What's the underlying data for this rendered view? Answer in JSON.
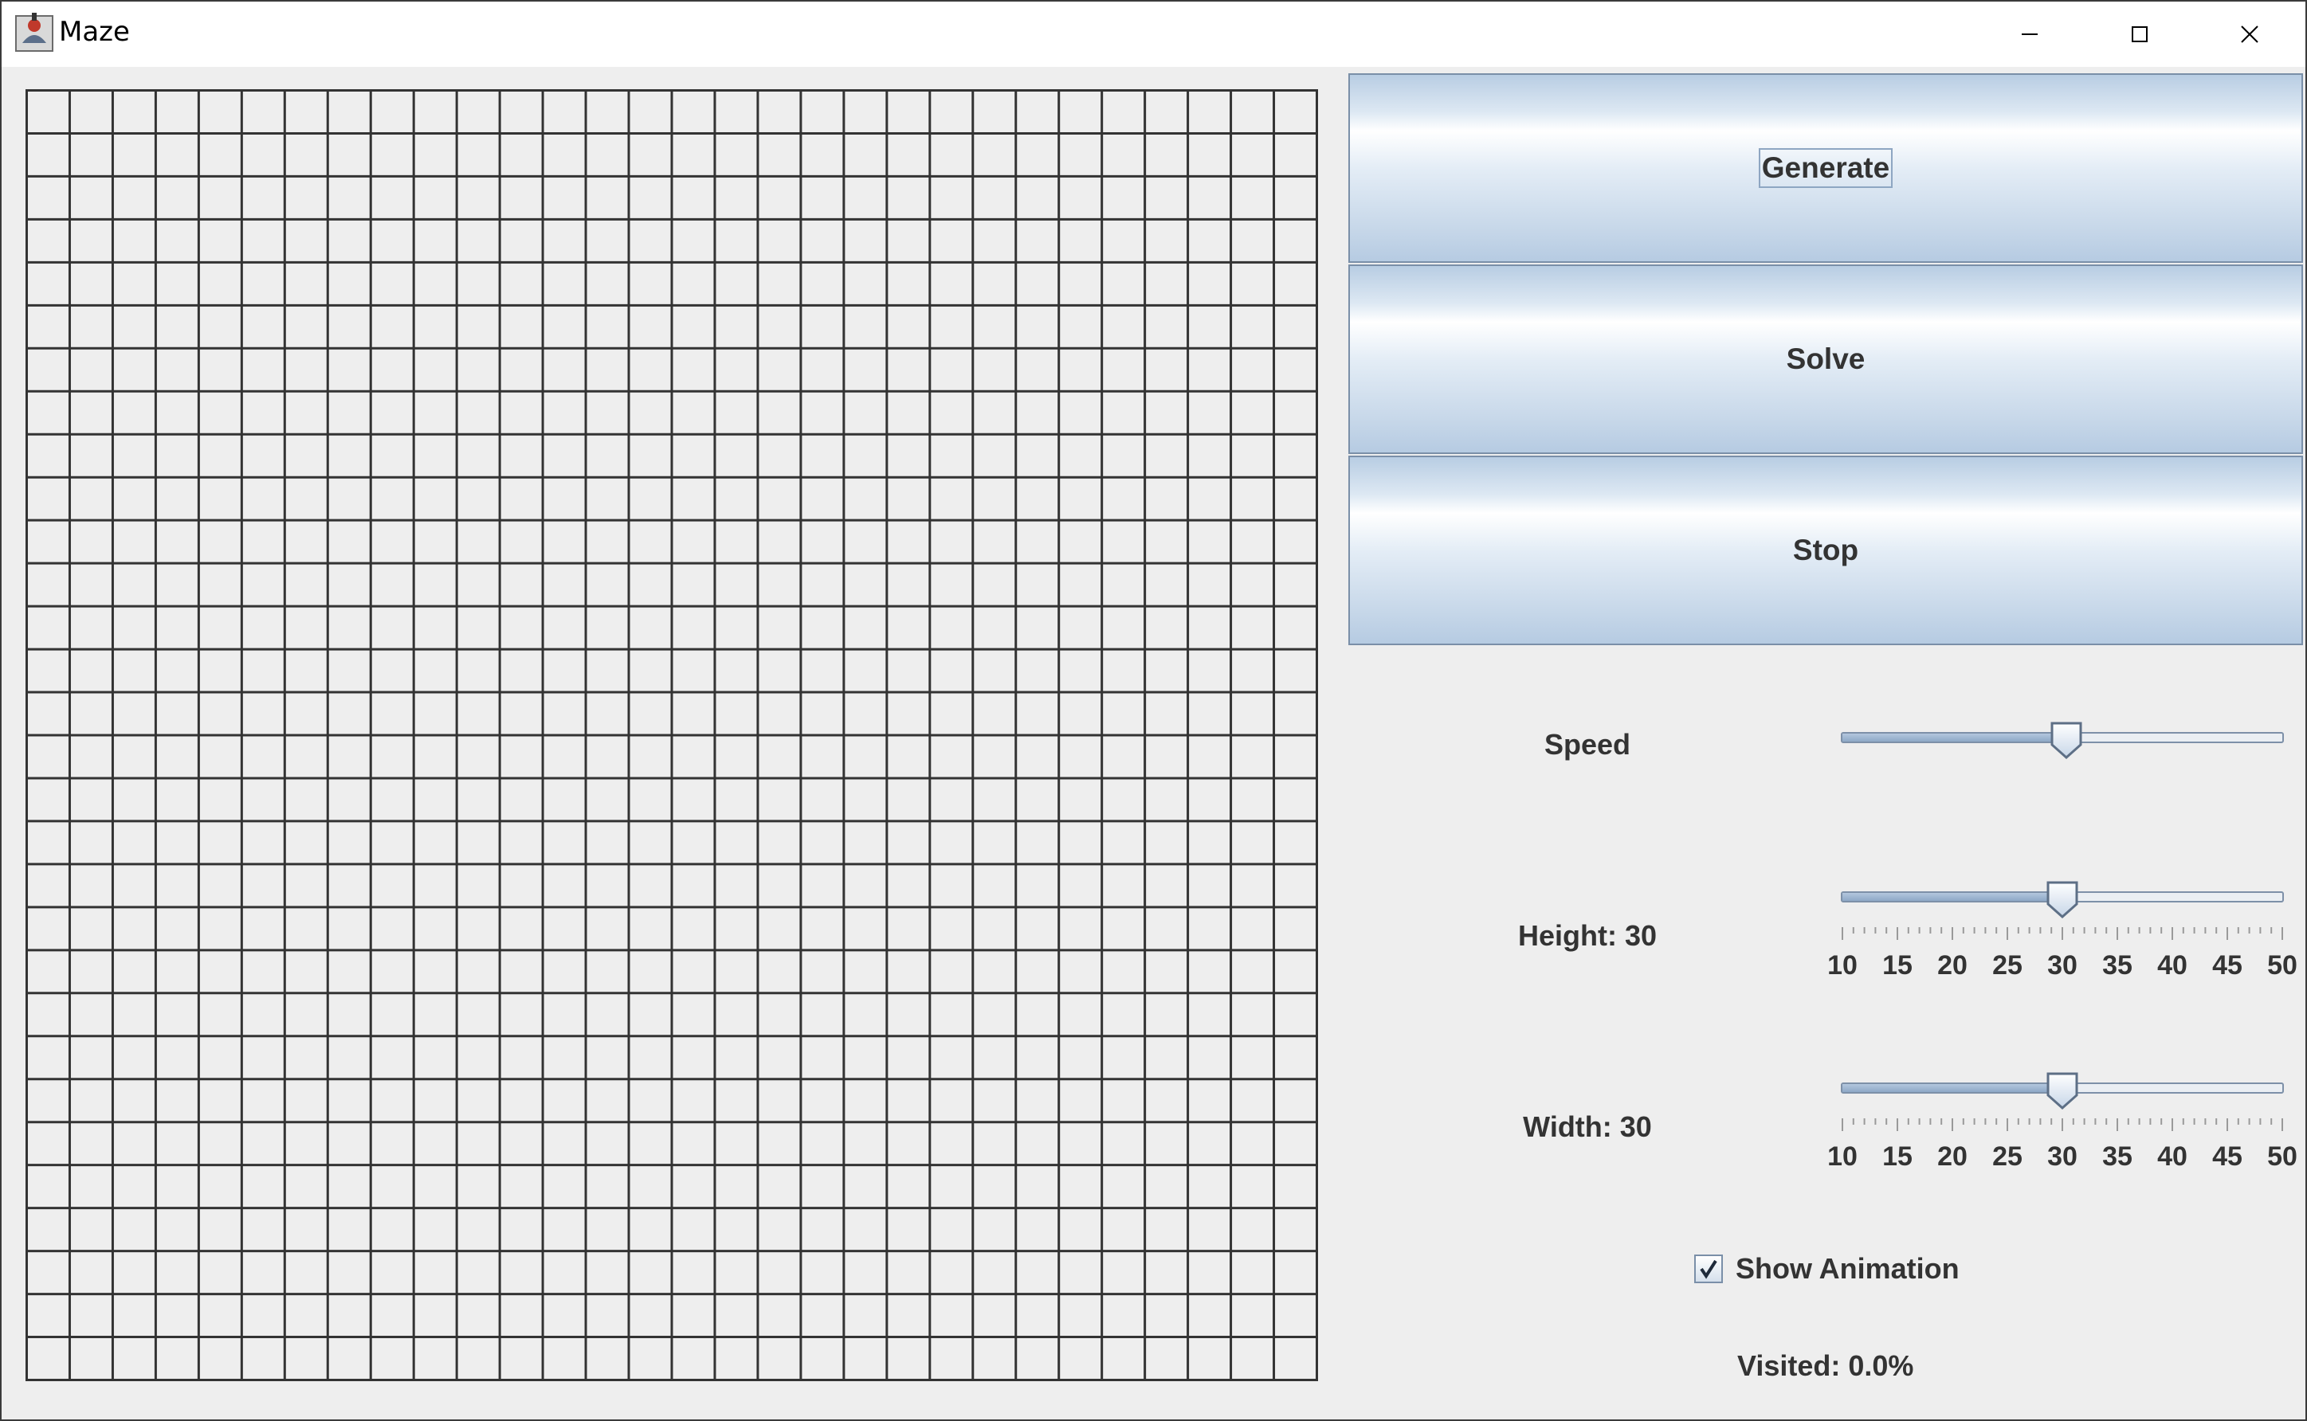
{
  "window": {
    "title": "Maze"
  },
  "maze": {
    "rows": 30,
    "cols": 30
  },
  "buttons": {
    "generate": "Generate",
    "solve": "Solve",
    "stop": "Stop"
  },
  "speed": {
    "label": "Speed",
    "value": 0.51
  },
  "height": {
    "label": "Height: 30",
    "value": 30,
    "min": 10,
    "max": 50,
    "tick_labels": [
      "10",
      "15",
      "20",
      "25",
      "30",
      "35",
      "40",
      "45",
      "50"
    ]
  },
  "width": {
    "label": "Width: 30",
    "value": 30,
    "min": 10,
    "max": 50,
    "tick_labels": [
      "10",
      "15",
      "20",
      "25",
      "30",
      "35",
      "40",
      "45",
      "50"
    ]
  },
  "show_animation": {
    "label": "Show Animation",
    "checked": true
  },
  "status": {
    "visited": "Visited: 0.0%"
  }
}
